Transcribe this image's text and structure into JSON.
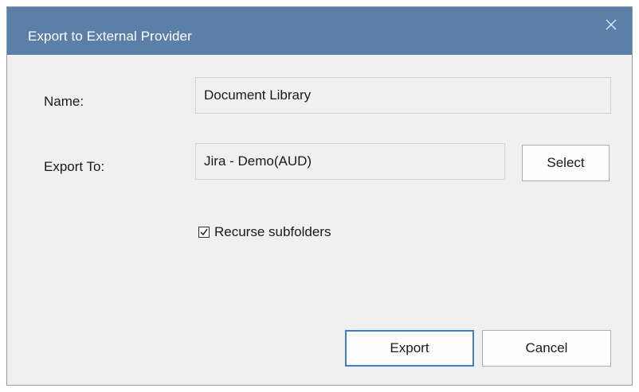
{
  "window": {
    "title": "Export to External Provider",
    "close_icon": "close-icon"
  },
  "form": {
    "name_label": "Name:",
    "name_value": "Document Library",
    "export_to_label": "Export To:",
    "export_to_value": "Jira - Demo(AUD)",
    "select_button": "Select",
    "recurse_label": "Recurse subfolders",
    "recurse_checked": true
  },
  "footer": {
    "export_button": "Export",
    "cancel_button": "Cancel"
  },
  "colors": {
    "titlebar": "#5b7fa8",
    "dialog_bg": "#f0f0f0",
    "default_button_border": "#3c7fd1"
  }
}
